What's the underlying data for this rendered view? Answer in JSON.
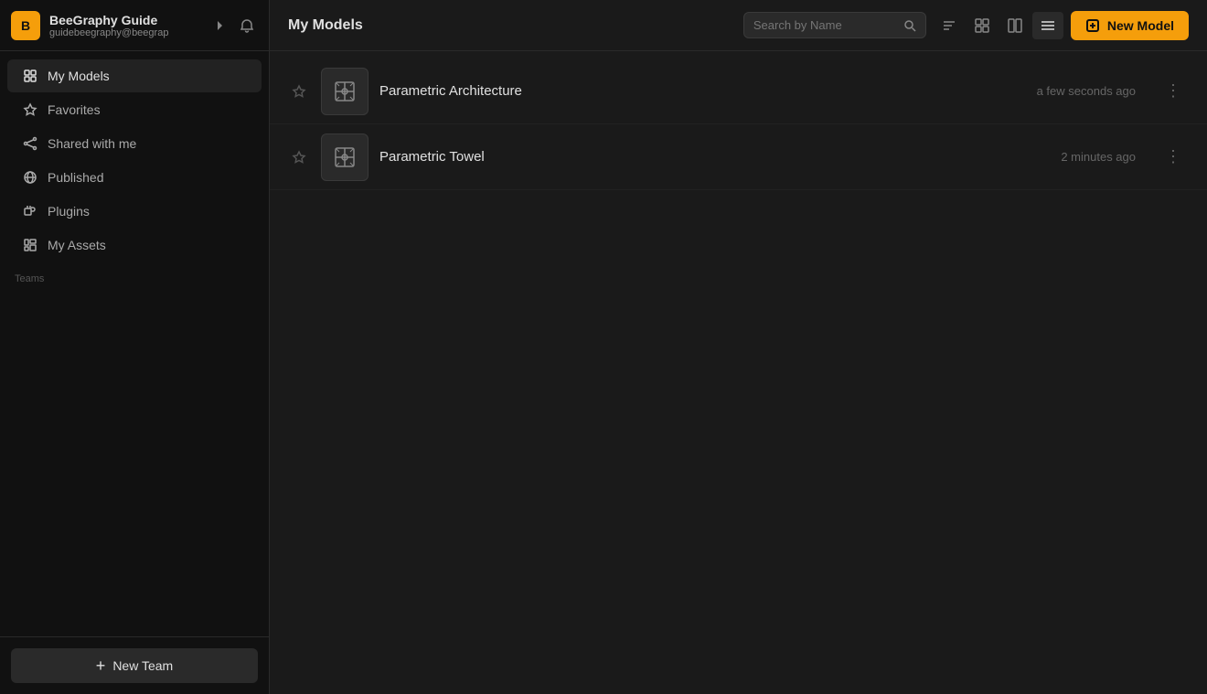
{
  "app": {
    "name": "BeeGraphy Guide",
    "email": "guidebeegraphy@beegrap"
  },
  "sidebar": {
    "nav_items": [
      {
        "id": "my-models",
        "label": "My Models",
        "icon": "grid-icon",
        "active": true
      },
      {
        "id": "favorites",
        "label": "Favorites",
        "icon": "star-icon",
        "active": false
      },
      {
        "id": "shared-with-me",
        "label": "Shared with me",
        "icon": "share-icon",
        "active": false
      },
      {
        "id": "published",
        "label": "Published",
        "icon": "globe-icon",
        "active": false
      },
      {
        "id": "plugins",
        "label": "Plugins",
        "icon": "plugin-icon",
        "active": false
      },
      {
        "id": "my-assets",
        "label": "My Assets",
        "icon": "assets-icon",
        "active": false
      }
    ],
    "teams_label": "Teams",
    "new_team_label": "New Team"
  },
  "header": {
    "page_title": "My Models",
    "search_placeholder": "Search by Name",
    "new_model_label": "New Model"
  },
  "models": [
    {
      "id": "model-1",
      "name": "Parametric Architecture",
      "updated": "a few seconds ago"
    },
    {
      "id": "model-2",
      "name": "Parametric Towel",
      "updated": "2 minutes ago"
    }
  ],
  "colors": {
    "accent": "#f59e0b",
    "bg_primary": "#1a1a1a",
    "bg_sidebar": "#111111",
    "text_primary": "#e0e0e0",
    "text_muted": "#888888"
  }
}
